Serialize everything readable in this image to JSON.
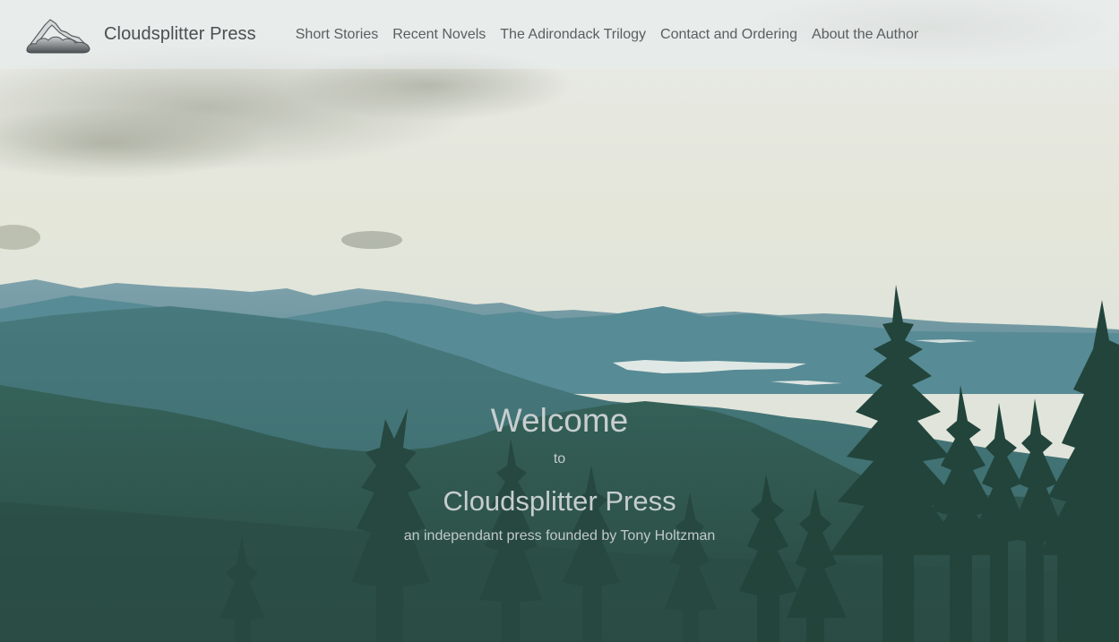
{
  "nav": {
    "brand": "Cloudsplitter Press",
    "links": [
      "Short Stories",
      "Recent Novels",
      "The Adirondack Trilogy",
      "Contact and Ordering",
      "About the Author"
    ]
  },
  "hero": {
    "welcome": "Welcome",
    "connector": "to",
    "title": "Cloudsplitter Press",
    "tagline": "an independant press founded by Tony Holtzman"
  },
  "colors": {
    "sky": "#e4e7dc",
    "mountain_far": "#5f8c98",
    "forest": "#254d46",
    "nav_text": "#5a5e61",
    "hero_text": "#c8ced0"
  }
}
